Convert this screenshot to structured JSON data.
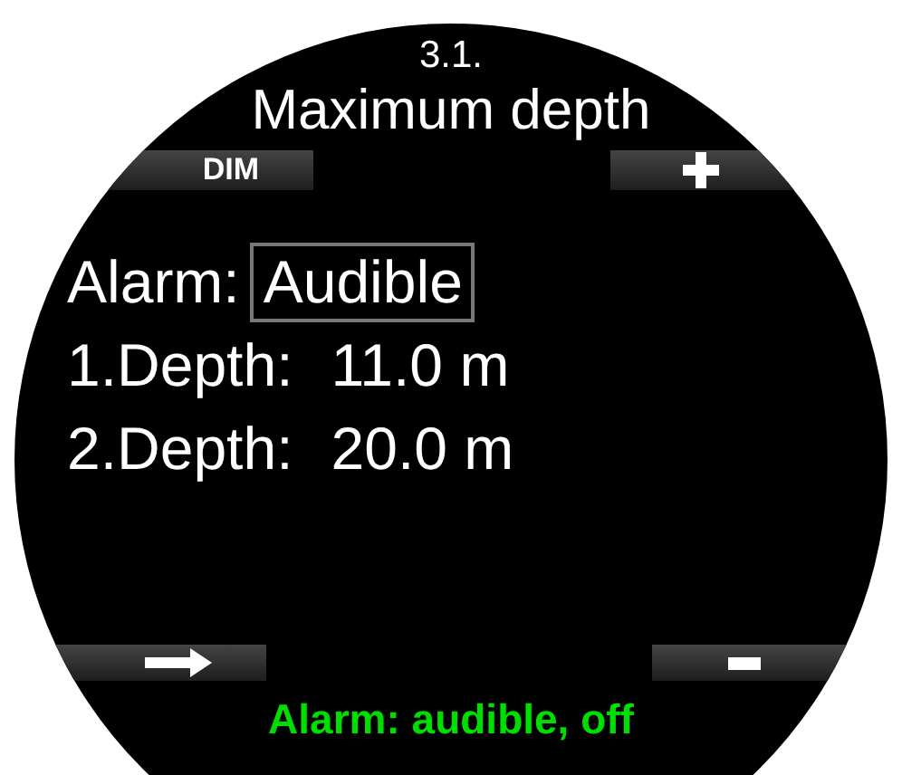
{
  "screen": {
    "section_number": "3.1.",
    "title": "Maximum depth",
    "top_keys": [
      {
        "kind": "label",
        "label": "DIM"
      },
      {
        "kind": "plus"
      }
    ],
    "settings": [
      {
        "label": "Alarm:",
        "value": "Audible",
        "selected": true
      },
      {
        "label": "1.Depth:",
        "value": "11.0 m",
        "selected": false
      },
      {
        "label": "2.Depth:",
        "value": "20.0 m",
        "selected": false
      }
    ],
    "bottom_keys": [
      {
        "kind": "arrow"
      },
      {
        "kind": "minus"
      }
    ],
    "hint": "Alarm: audible, off"
  }
}
